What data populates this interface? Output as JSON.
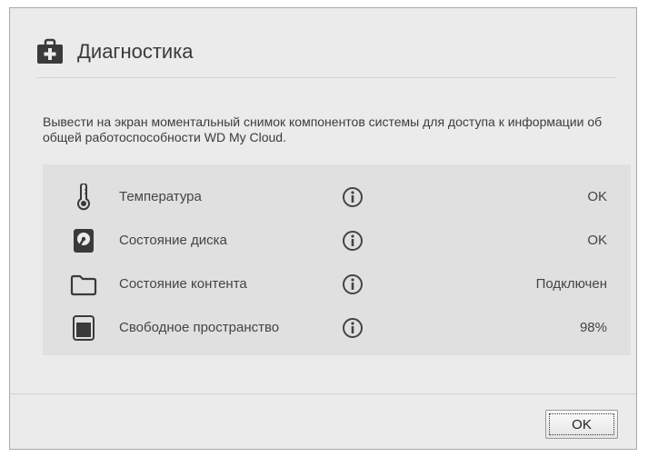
{
  "dialog": {
    "title": "Диагностика",
    "title_icon": "medical-kit-icon",
    "description": "Вывести на экран моментальный снимок компонентов системы для доступа к информации об общей работоспособности WD My Cloud.",
    "rows": [
      {
        "icon": "thermometer-icon",
        "label": "Температура",
        "value": "OK"
      },
      {
        "icon": "disk-icon",
        "label": "Состояние диска",
        "value": "OK"
      },
      {
        "icon": "folder-icon",
        "label": "Состояние контента",
        "value": "Подключен"
      },
      {
        "icon": "storage-icon",
        "label": "Свободное пространство",
        "value": "98%"
      }
    ],
    "ok_label": "OK"
  }
}
